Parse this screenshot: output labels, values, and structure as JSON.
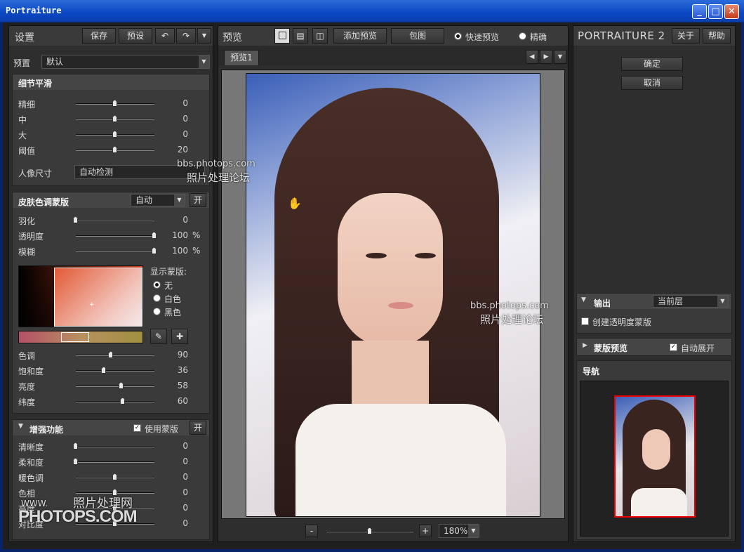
{
  "window": {
    "title": "Portraiture"
  },
  "left": {
    "header": {
      "title": "设置",
      "save": "保存",
      "preset": "预设",
      "undo_icon": "undo-icon",
      "redo_icon": "redo-icon",
      "menu_icon": "triangle-down-icon"
    },
    "preset_row": {
      "label": "预置",
      "value": "默认"
    },
    "detail": {
      "title": "细节平滑",
      "sliders": [
        {
          "label": "精细",
          "value": "0",
          "pos": 0.5
        },
        {
          "label": "中",
          "value": "0",
          "pos": 0.5
        },
        {
          "label": "大",
          "value": "0",
          "pos": 0.5
        },
        {
          "label": "阈值",
          "value": "20",
          "pos": 0.5
        }
      ],
      "portrait_size": {
        "label": "人像尺寸",
        "value": "自动检测"
      }
    },
    "skin": {
      "title": "皮肤色调蒙版",
      "mode": "自动",
      "toggle": "开",
      "sliders": [
        {
          "label": "羽化",
          "value": "0",
          "unit": "",
          "pos": 0.0
        },
        {
          "label": "透明度",
          "value": "100",
          "unit": "%",
          "pos": 1.0
        },
        {
          "label": "模糊",
          "value": "100",
          "unit": "%",
          "pos": 1.0
        }
      ],
      "show_mask": "显示蒙版:",
      "mask_options": [
        "无",
        "白色",
        "黑色"
      ],
      "mask_selected": 0,
      "color_sliders": [
        {
          "label": "色调",
          "value": "90",
          "pos": 0.45
        },
        {
          "label": "饱和度",
          "value": "36",
          "pos": 0.36
        },
        {
          "label": "亮度",
          "value": "58",
          "pos": 0.58
        },
        {
          "label": "纬度",
          "value": "60",
          "pos": 0.6
        }
      ]
    },
    "enhance": {
      "title": "增强功能",
      "use_mask": "使用蒙版",
      "toggle": "开",
      "sliders": [
        {
          "label": "清晰度",
          "value": "0",
          "pos": 0.0
        },
        {
          "label": "柔和度",
          "value": "0",
          "pos": 0.0
        },
        {
          "label": "暖色调",
          "value": "0",
          "pos": 0.5
        },
        {
          "label": "色相",
          "value": "0",
          "pos": 0.5
        },
        {
          "label": "亮度",
          "value": "0",
          "pos": 0.5
        },
        {
          "label": "对比度",
          "value": "0",
          "pos": 0.5
        }
      ]
    }
  },
  "center": {
    "header": {
      "title": "预览",
      "add_preview": "添加预览",
      "crop": "包图",
      "fast_preview": "快速预览",
      "accurate": "精确",
      "selected_mode": "fast"
    },
    "tab": "预览1",
    "zoom": {
      "minus": "-",
      "plus": "+",
      "level": "180%",
      "pos": 0.5
    }
  },
  "right": {
    "brand": "PORTRAITURE 2",
    "about": "关于",
    "help": "帮助",
    "ok": "确定",
    "cancel": "取消",
    "output": {
      "title": "输出",
      "value": "当前层",
      "create_mask": "创建透明度蒙版",
      "create_mask_checked": false
    },
    "mask_preview": {
      "title": "蒙版预览",
      "auto_expand": "自动展开",
      "auto_expand_checked": true
    },
    "navigator": {
      "title": "导航"
    }
  },
  "watermarks": {
    "url": "bbs.photops.com",
    "forum": "照片处理论坛",
    "site_cn": "照片处理网",
    "www": "WWW.",
    "site": "PHOTOPS.COM"
  }
}
